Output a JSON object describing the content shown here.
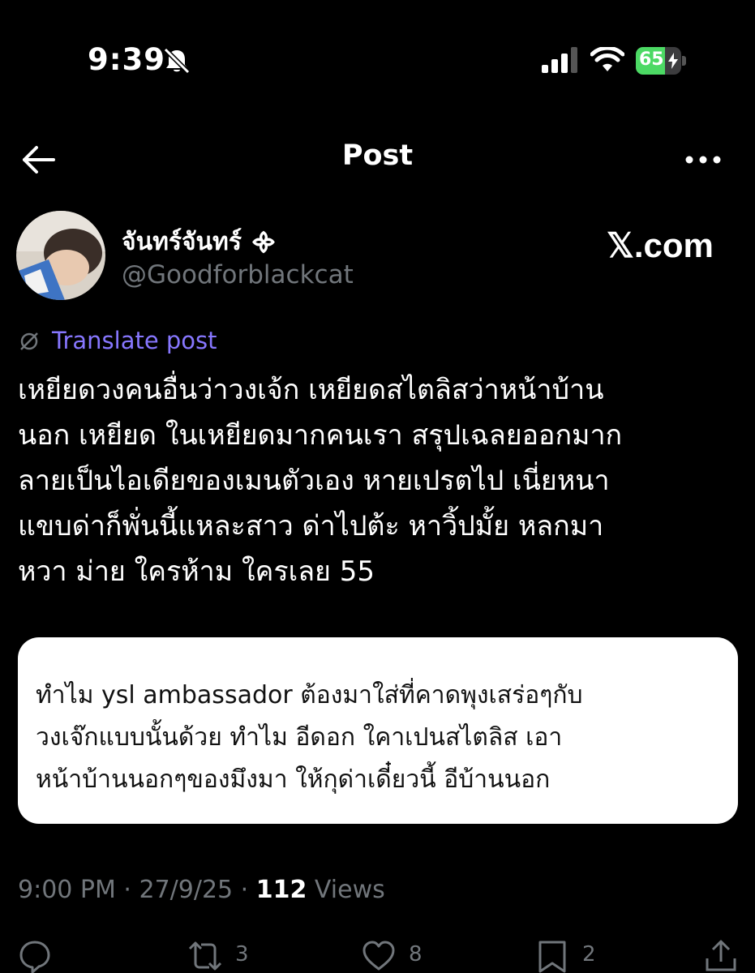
{
  "status_bar": {
    "time": "9:39",
    "battery_level": "65",
    "icons": [
      "bell-slash-icon",
      "signal-icon",
      "wifi-icon",
      "battery-charging-icon"
    ]
  },
  "nav": {
    "title": "Post",
    "icons": [
      "back-arrow-icon",
      "more-icon"
    ]
  },
  "post": {
    "author_name": "จันทร์จันทร์ ᯽",
    "author_handle": "@Goodforblackcat",
    "watermark": "𝕏.com",
    "translate_label": "Translate post",
    "text": "เหยียดวงคนอื่นว่าวงเจ้ก เหยียดสไตลิสว่าหน้าบ้าน\nนอก เหยียด ในเหยียดมากคนเรา สรุปเฉลยออกมาก\nลายเป็นไอเดียของเมนตัวเอง หายเปรตไป เนี่ยหนา\nแขบด่าก็พั่นนี้แหละสาว ด่าไปต้ะ หาวิ้ปมั้ย หลกมา\nหวา ม่าย ใครห้าม ใครเลย 55",
    "image_text": "ทำไม ysl ambassador ต้องมาใส่ที่คาดพุงเสร่อๆกับ\nวงเจ๊กแบบนั้นด้วย ทำไม อีดอก ใคาเปนสไตลิส เอา\nหน้าบ้านนอกๆของมึงมา ให้กุด่าเดี๋ยวนี้ อีบ้านนอก",
    "timestamp": "9:00 PM · 27/9/25 · ",
    "views_count": "112",
    "views_label": " Views"
  },
  "actions": {
    "reply_count": "",
    "repost_count": "3",
    "like_count": "8",
    "bookmark_count": "2",
    "share_count": ""
  },
  "colors": {
    "background": "#000000",
    "text": "#ffffff",
    "muted": "#71767b",
    "link": "#8777ff",
    "battery": "#4cd964"
  }
}
